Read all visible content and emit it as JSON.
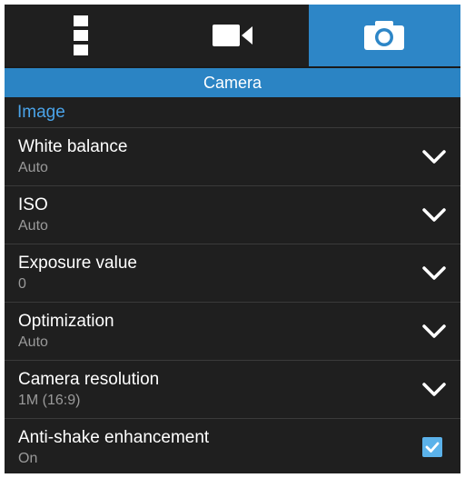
{
  "tabs": [
    {
      "icon": "more-vert-icon",
      "active": false
    },
    {
      "icon": "video-camera-icon",
      "active": false
    },
    {
      "icon": "camera-icon",
      "active": true
    }
  ],
  "header": {
    "title": "Camera"
  },
  "section": {
    "title": "Image"
  },
  "settings": [
    {
      "title": "White balance",
      "value": "Auto",
      "control": "dropdown"
    },
    {
      "title": "ISO",
      "value": "Auto",
      "control": "dropdown"
    },
    {
      "title": "Exposure value",
      "value": "0",
      "control": "dropdown"
    },
    {
      "title": "Optimization",
      "value": "Auto",
      "control": "dropdown"
    },
    {
      "title": "Camera resolution",
      "value": "1M (16:9)",
      "control": "dropdown"
    },
    {
      "title": "Anti-shake enhancement",
      "value": "On",
      "control": "checkbox",
      "checked": true
    }
  ],
  "colors": {
    "accent": "#2b84c4",
    "section_text": "#4aa3e8",
    "background": "#1f1f1f",
    "checkbox": "#5bb2ea"
  }
}
